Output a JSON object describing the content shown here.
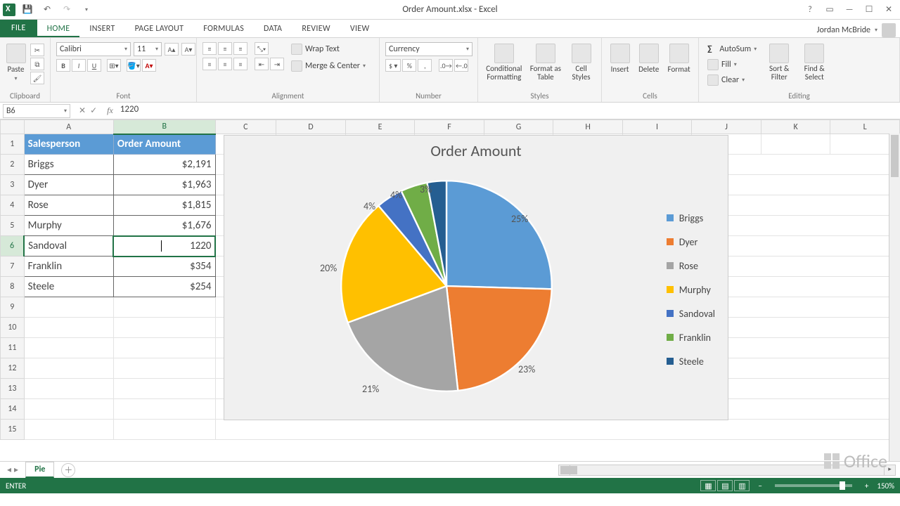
{
  "app": {
    "title": "Order Amount.xlsx - Excel",
    "user": "Jordan McBride"
  },
  "qat": {
    "save": "💾",
    "undo": "↶",
    "redo": "↷"
  },
  "tabs": [
    "FILE",
    "HOME",
    "INSERT",
    "PAGE LAYOUT",
    "FORMULAS",
    "DATA",
    "REVIEW",
    "VIEW"
  ],
  "ribbon": {
    "clipboard": {
      "label": "Clipboard",
      "paste": "Paste"
    },
    "font": {
      "label": "Font",
      "name": "Calibri",
      "size": "11",
      "bold": "B",
      "italic": "I",
      "underline": "U"
    },
    "alignment": {
      "label": "Alignment",
      "wrap": "Wrap Text",
      "merge": "Merge & Center"
    },
    "number": {
      "label": "Number",
      "format": "Currency"
    },
    "styles": {
      "label": "Styles",
      "cond": "Conditional Formatting",
      "fmt": "Format as Table",
      "cell": "Cell Styles"
    },
    "cells": {
      "label": "Cells",
      "insert": "Insert",
      "delete": "Delete",
      "format": "Format"
    },
    "editing": {
      "label": "Editing",
      "autosum": "AutoSum",
      "fill": "Fill",
      "clear": "Clear",
      "sort": "Sort & Filter",
      "find": "Find & Select"
    }
  },
  "fx": {
    "cellref": "B6",
    "value": "1220"
  },
  "columns": [
    "A",
    "B",
    "C",
    "D",
    "E",
    "F",
    "G",
    "H",
    "I",
    "J",
    "K",
    "L"
  ],
  "headers": {
    "a": "Salesperson",
    "b": "Order Amount"
  },
  "rows": [
    {
      "n": "2",
      "a": "Briggs",
      "b": "$2,191"
    },
    {
      "n": "3",
      "a": "Dyer",
      "b": "$1,963"
    },
    {
      "n": "4",
      "a": "Rose",
      "b": "$1,815"
    },
    {
      "n": "5",
      "a": "Murphy",
      "b": "$1,676"
    },
    {
      "n": "6",
      "a": "Sandoval",
      "b": "1220"
    },
    {
      "n": "7",
      "a": "Franklin",
      "b": "$354"
    },
    {
      "n": "8",
      "a": "Steele",
      "b": "$254"
    }
  ],
  "chart_data": {
    "type": "pie",
    "title": "Order Amount",
    "series": [
      {
        "name": "Order Amount",
        "values": [
          2191,
          1963,
          1815,
          1676,
          354,
          354,
          254
        ]
      }
    ],
    "categories": [
      "Briggs",
      "Dyer",
      "Rose",
      "Murphy",
      "Sandoval",
      "Franklin",
      "Steele"
    ],
    "percent_labels": [
      "25%",
      "23%",
      "21%",
      "20%",
      "4%",
      "4%",
      "3%"
    ],
    "colors": [
      "#5b9bd5",
      "#ed7d31",
      "#a5a5a5",
      "#ffc000",
      "#4472c4",
      "#70ad47",
      "#255e91"
    ]
  },
  "sheet_tabs": {
    "active": "Pie"
  },
  "status": {
    "mode": "ENTER",
    "zoom": "150%"
  },
  "watermark": "Office"
}
